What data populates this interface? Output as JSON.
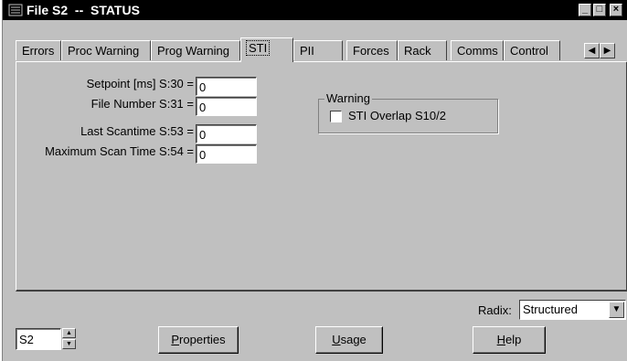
{
  "window": {
    "title": "File S2  --  STATUS"
  },
  "caption_buttons": {
    "minimize": "_",
    "maximize": "□",
    "close": "×"
  },
  "tabs": [
    "Errors",
    "Proc Warning",
    "Prog Warning",
    "STI",
    "PII",
    "Forces",
    "Rack",
    "Comms",
    "Control"
  ],
  "active_tab": "STI",
  "fields": [
    {
      "label": "Setpoint [ms] S:30 =",
      "value": "0"
    },
    {
      "label": "File Number S:31 =",
      "value": "0"
    },
    {
      "label": "Last Scantime S:53 =",
      "value": "0"
    },
    {
      "label": "Maximum Scan Time S:54 =",
      "value": "0"
    }
  ],
  "warning_group": {
    "legend": "Warning",
    "checkbox_label": "STI Overlap S10/2",
    "checked": false
  },
  "radix": {
    "label": "Radix:",
    "value": "Structured"
  },
  "file_selector": {
    "value": "S2"
  },
  "buttons": {
    "properties": {
      "first": "P",
      "rest": "roperties"
    },
    "usage": {
      "first": "U",
      "rest": "sage"
    },
    "help": {
      "first": "H",
      "rest": "elp"
    }
  }
}
